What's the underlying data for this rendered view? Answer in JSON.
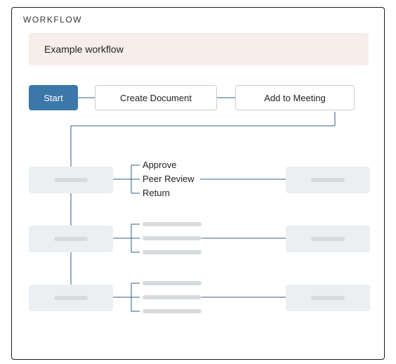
{
  "panel": {
    "header": "WORKFLOW",
    "title": "Example workflow"
  },
  "row1": {
    "start": "Start",
    "create": "Create Document",
    "add": "Add to Meeting"
  },
  "options": {
    "o1": "Approve",
    "o2": "Peer Review",
    "o3": "Return"
  }
}
